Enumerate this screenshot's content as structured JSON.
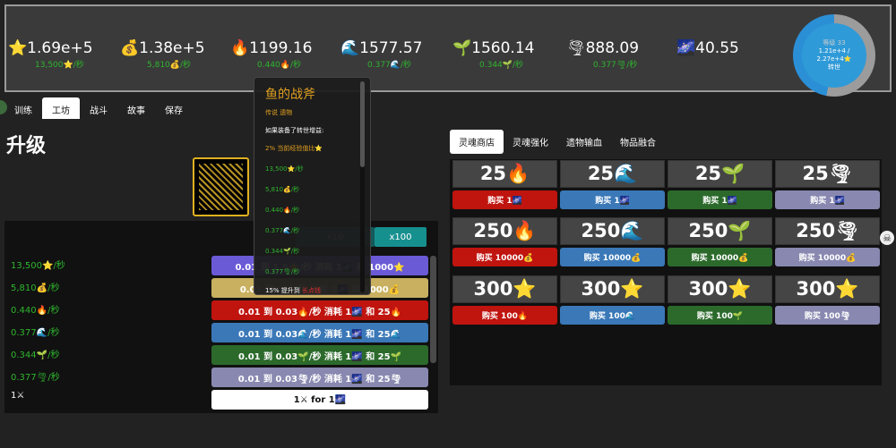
{
  "resources": [
    {
      "main": "⭐1.69e+5",
      "rate": "13,500⭐/秒"
    },
    {
      "main": "💰1.38e+5",
      "rate": "5,810💰/秒"
    },
    {
      "main": "🔥1199.16",
      "rate": "0.440🔥/秒"
    },
    {
      "main": "🌊1577.57",
      "rate": "0.377🌊/秒"
    },
    {
      "main": "🌱1560.14",
      "rate": "0.344🌱/秒"
    },
    {
      "main": "🌪888.09",
      "rate": "0.377🌪/秒"
    },
    {
      "main": "🌌40.55",
      "rate": ""
    }
  ],
  "level": {
    "label": "等级 33",
    "progress_text": "1.21e+4 / 2.27e+4⭐",
    "rebirth": "转世",
    "progress": 0.53
  },
  "nav": [
    "训练",
    "工坊",
    "战斗",
    "故事",
    "保存"
  ],
  "page_title": "升级",
  "multipliers": {
    "x10": "x10",
    "x100": "x100"
  },
  "left_rates": [
    "13,500⭐/秒",
    "5,810💰/秒",
    "0.440🔥/秒",
    "0.377🌊/秒",
    "0.344🌱/秒",
    "0.377🌪/秒",
    "1⚔"
  ],
  "upgrade_buttons": [
    {
      "label": "0.01 到 1.5⭐/秒 消耗 1🌌 和 1000⭐",
      "color": "#6a5ad6"
    },
    {
      "label": "0.01 到 5💰/秒 消耗 1🌌 和 1000💰",
      "color": "#c8b060"
    },
    {
      "label": "0.01 到 0.03🔥/秒 消耗 1🌌 和 25🔥",
      "color": "#c0140f"
    },
    {
      "label": "0.01 到 0.03🌊/秒 消耗 1🌌 和 25🌊",
      "color": "#3a78b8"
    },
    {
      "label": "0.01 到 0.03🌱/秒 消耗 1🌌 和 25🌱",
      "color": "#2c6a2c"
    },
    {
      "label": "0.01 到 0.03🌪/秒 消耗 1🌌 和 25🌪",
      "color": "#8888b0"
    },
    {
      "label": "1⚔ for 1🌌",
      "color": "#ffffff"
    }
  ],
  "tooltip": {
    "title": "鱼的战斧",
    "subtitle": "传说 遗物",
    "condition": "如果装备了转世增益:",
    "bonus": "2% 当前经验值比⭐",
    "rates": [
      "13,500⭐/秒",
      "5,810💰/秒",
      "0.440🔥/秒",
      "0.377🌊/秒",
      "0.344🌱/秒",
      "0.377🌪/秒"
    ],
    "footer_pre": "15% 提升到 ",
    "footer_red": "长点钱"
  },
  "shop_tabs": [
    "灵魂商店",
    "灵魂强化",
    "遗物输血",
    "物品融合"
  ],
  "shop_rows": [
    {
      "cells": [
        "25🔥",
        "25🌊",
        "25🌱",
        "25🌪"
      ],
      "buys": [
        "购买 1🌌",
        "购买 1🌌",
        "购买 1🌌",
        "购买 1🌌"
      ]
    },
    {
      "cells": [
        "250🔥",
        "250🌊",
        "250🌱",
        "250🌪"
      ],
      "buys": [
        "购买 10000💰",
        "购买 10000💰",
        "购买 10000💰",
        "购买 10000💰"
      ]
    },
    {
      "cells": [
        "300⭐",
        "300⭐",
        "300⭐",
        "300⭐"
      ],
      "buys": [
        "购买 100🔥",
        "购买 100🌊",
        "购买 100🌱",
        "购买 100🌪"
      ]
    }
  ],
  "shop_colors": [
    "#c0140f",
    "#3a78b8",
    "#2c6a2c",
    "#8888b0"
  ],
  "skull_icon": "☠"
}
